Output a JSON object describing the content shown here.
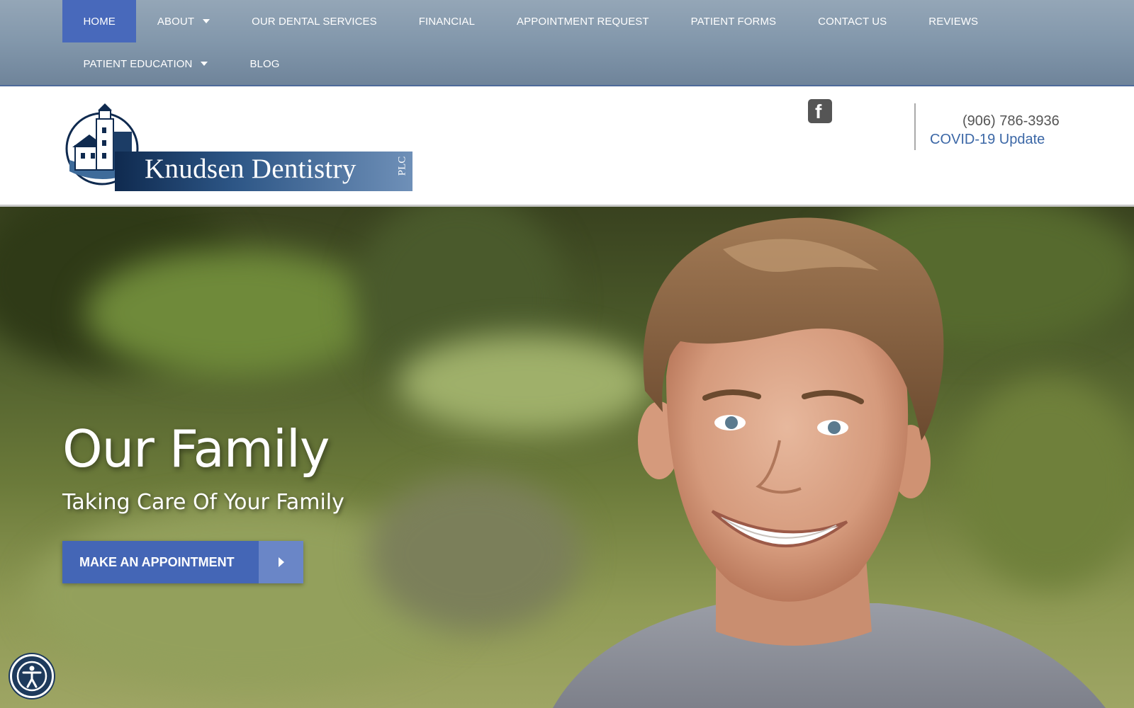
{
  "nav": {
    "row1": [
      {
        "label": "HOME",
        "active": true,
        "dropdown": false
      },
      {
        "label": "ABOUT",
        "active": false,
        "dropdown": true
      },
      {
        "label": "OUR DENTAL SERVICES",
        "active": false,
        "dropdown": false
      },
      {
        "label": "FINANCIAL",
        "active": false,
        "dropdown": false
      },
      {
        "label": "APPOINTMENT REQUEST",
        "active": false,
        "dropdown": false
      },
      {
        "label": "PATIENT FORMS",
        "active": false,
        "dropdown": false
      },
      {
        "label": "CONTACT US",
        "active": false,
        "dropdown": false
      },
      {
        "label": "REVIEWS",
        "active": false,
        "dropdown": false
      }
    ],
    "row2": [
      {
        "label": "PATIENT EDUCATION",
        "active": false,
        "dropdown": true
      },
      {
        "label": "BLOG",
        "active": false,
        "dropdown": false
      }
    ]
  },
  "header": {
    "logo_name": "Knudsen Dentistry",
    "logo_suffix": "PLC",
    "social_icon": "facebook-icon",
    "phone": "(906) 786-3936",
    "covid_link": "COVID-19 Update"
  },
  "hero": {
    "title": "Our Family",
    "subtitle": "Taking Care Of Your Family",
    "cta_label": "MAKE AN APPOINTMENT",
    "cta_icon": "caret-right-icon"
  },
  "accessibility": {
    "icon": "accessibility-icon"
  },
  "colors": {
    "nav_active": "#4869bb",
    "cta_blue": "#4466b6",
    "link_blue": "#3b67a6"
  }
}
